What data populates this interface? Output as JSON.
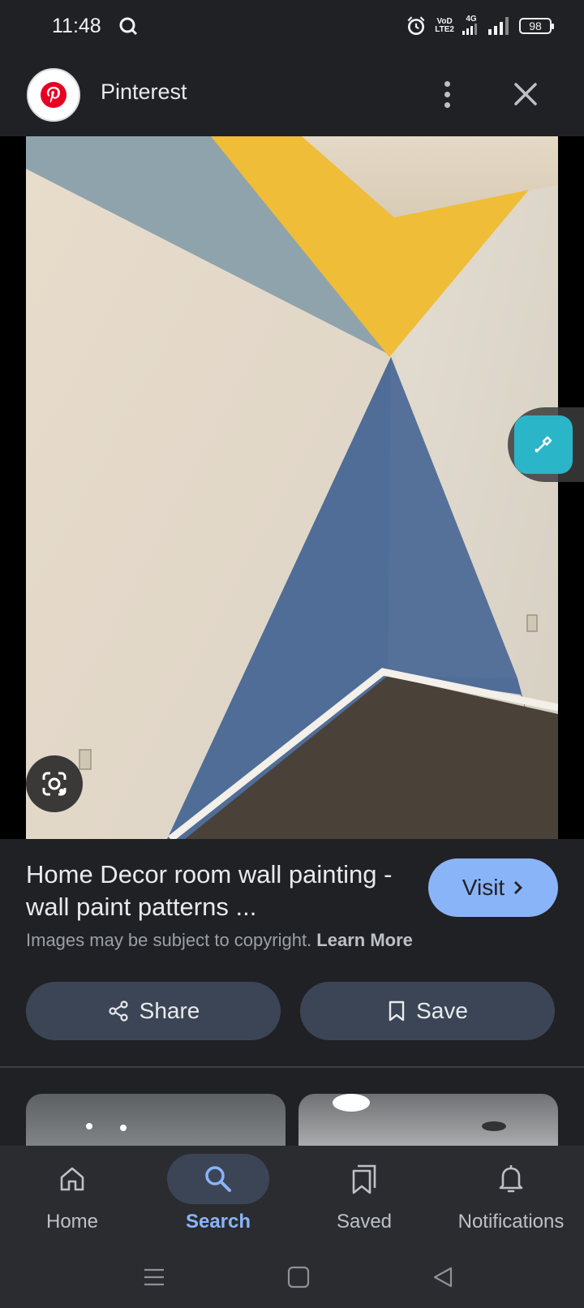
{
  "status_bar": {
    "time": "11:48",
    "network_label_top": "VoD",
    "network_label_bottom": "LTE2",
    "network_type": "4G",
    "battery": "98",
    "icons": [
      "search-icon",
      "alarm-icon",
      "signal-icon",
      "signal-icon"
    ]
  },
  "header": {
    "site_name": "Pinterest",
    "logo_icon": "pinterest-logo",
    "more_icon": "more-vert-icon",
    "close_icon": "close-icon"
  },
  "image": {
    "edit_icon": "eyedropper-icon",
    "lens_icon": "lens-icon"
  },
  "info": {
    "title": "Home Decor room wall painting - wall paint patterns ...",
    "visit_label": "Visit",
    "copyright_text": "Images may be subject to copyright.",
    "learn_more": "Learn More",
    "share_label": "Share",
    "save_label": "Save"
  },
  "bottom_nav": {
    "items": [
      {
        "label": "Home",
        "icon": "home-icon"
      },
      {
        "label": "Search",
        "icon": "search-icon",
        "active": true
      },
      {
        "label": "Saved",
        "icon": "saved-icon"
      },
      {
        "label": "Notifications",
        "icon": "bell-icon"
      }
    ]
  },
  "colors": {
    "accent": "#8ab4f8",
    "background": "#202124",
    "button": "#3c4556",
    "edit_fab": "#2bb5c8",
    "pinterest_red": "#e60023"
  }
}
